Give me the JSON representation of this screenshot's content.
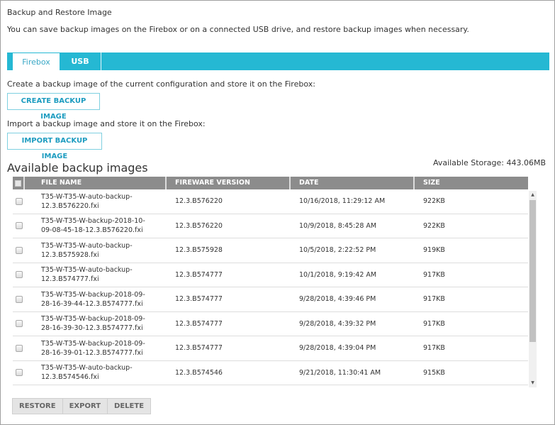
{
  "header": {
    "title": "Backup and Restore Image",
    "description": "You can save backup images on the Firebox or on a connected USB drive, and restore backup images when necessary."
  },
  "tabs": [
    {
      "label": "Firebox",
      "active": true
    },
    {
      "label": "USB",
      "active": false
    }
  ],
  "create": {
    "label": "Create a backup image of the current configuration and store it on the Firebox:",
    "button": "CREATE BACKUP IMAGE"
  },
  "import": {
    "label": "Import a backup image and store it on the Firebox:",
    "button": "IMPORT BACKUP IMAGE"
  },
  "table": {
    "title": "Available backup images",
    "storage": "Available Storage: 443.06MB",
    "columns": [
      "FILE NAME",
      "FIREWARE VERSION",
      "DATE",
      "SIZE"
    ],
    "rows": [
      {
        "file": [
          "T35-W-T35-W-auto-backup-",
          "12.3.B576220.fxi"
        ],
        "version": "12.3.B576220",
        "date": "10/16/2018, 11:29:12 AM",
        "size": "922KB"
      },
      {
        "file": [
          "T35-W-T35-W-backup-2018-10-",
          "09-08-45-18-12.3.B576220.fxi"
        ],
        "version": "12.3.B576220",
        "date": "10/9/2018, 8:45:28 AM",
        "size": "922KB"
      },
      {
        "file": [
          "T35-W-T35-W-auto-backup-",
          "12.3.B575928.fxi"
        ],
        "version": "12.3.B575928",
        "date": "10/5/2018, 2:22:52 PM",
        "size": "919KB"
      },
      {
        "file": [
          "T35-W-T35-W-auto-backup-",
          "12.3.B574777.fxi"
        ],
        "version": "12.3.B574777",
        "date": "10/1/2018, 9:19:42 AM",
        "size": "917KB"
      },
      {
        "file": [
          "T35-W-T35-W-backup-2018-09-",
          "28-16-39-44-12.3.B574777.fxi"
        ],
        "version": "12.3.B574777",
        "date": "9/28/2018, 4:39:46 PM",
        "size": "917KB"
      },
      {
        "file": [
          "T35-W-T35-W-backup-2018-09-",
          "28-16-39-30-12.3.B574777.fxi"
        ],
        "version": "12.3.B574777",
        "date": "9/28/2018, 4:39:32 PM",
        "size": "917KB"
      },
      {
        "file": [
          "T35-W-T35-W-backup-2018-09-",
          "28-16-39-01-12.3.B574777.fxi"
        ],
        "version": "12.3.B574777",
        "date": "9/28/2018, 4:39:04 PM",
        "size": "917KB"
      },
      {
        "file": [
          "T35-W-T35-W-auto-backup-",
          "12.3.B574546.fxi"
        ],
        "version": "12.3.B574546",
        "date": "9/21/2018, 11:30:41 AM",
        "size": "915KB"
      }
    ]
  },
  "actions": [
    "RESTORE",
    "EXPORT",
    "DELETE"
  ],
  "colors": {
    "accent": "#25b8d3",
    "button_text": "#1d9cc0",
    "header_bg": "#8c8c8c"
  }
}
